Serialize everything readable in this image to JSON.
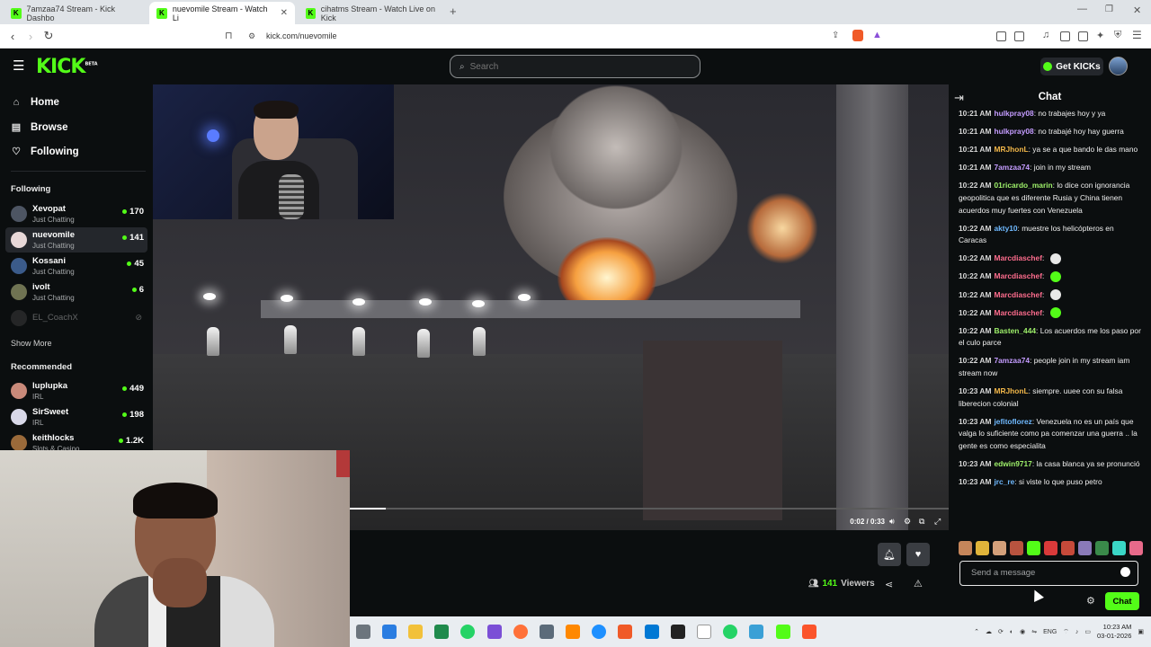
{
  "browser": {
    "tabs": [
      {
        "label": "7amzaa74 Stream - Kick Dashbo",
        "active": false
      },
      {
        "label": "nuevomile Stream - Watch Li",
        "active": true
      },
      {
        "label": "cihatms Stream - Watch Live on Kick",
        "active": false
      }
    ],
    "url": "kick.com/nuevomile"
  },
  "header": {
    "logo": "KICK",
    "logo_tag": "BETA",
    "search_placeholder": "Search",
    "get_kicks_label": "Get KICKs"
  },
  "sidebar": {
    "nav": [
      {
        "label": "Home",
        "icon": "home-icon"
      },
      {
        "label": "Browse",
        "icon": "browse-icon"
      },
      {
        "label": "Following",
        "icon": "heart-icon"
      }
    ],
    "following_title": "Following",
    "following": [
      {
        "name": "Xevopat",
        "category": "Just Chatting",
        "viewers": "170"
      },
      {
        "name": "nuevomile",
        "category": "Just Chatting",
        "viewers": "141"
      },
      {
        "name": "Kossani",
        "category": "Just Chatting",
        "viewers": "45"
      },
      {
        "name": "ivolt",
        "category": "Just Chatting",
        "viewers": "6"
      },
      {
        "name": "EL_CoachX",
        "category": "",
        "viewers": ""
      }
    ],
    "show_more": "Show More",
    "recommended_title": "Recommended",
    "recommended": [
      {
        "name": "luplupka",
        "category": "IRL",
        "viewers": "449"
      },
      {
        "name": "SirSweet",
        "category": "IRL",
        "viewers": "198"
      },
      {
        "name": "keithlocks",
        "category": "Slots & Casino",
        "viewers": "1.2K"
      }
    ]
  },
  "player": {
    "time": "0:02 / 0:33",
    "progress": 0.06
  },
  "stream_info": {
    "viewers_count": "141",
    "viewers_label": "Viewers"
  },
  "chat": {
    "title": "Chat",
    "messages": [
      {
        "time": "10:21 AM",
        "user": "hulkpray08",
        "color": "#c49cff",
        "text": "no trabajes hoy y ya"
      },
      {
        "time": "10:21 AM",
        "user": "hulkpray08",
        "color": "#c49cff",
        "text": "no trabajé hoy hay guerra"
      },
      {
        "time": "10:21 AM",
        "user": "MRJhonL",
        "color": "#f2b749",
        "text": "ya se a que bando le das mano"
      },
      {
        "time": "10:21 AM",
        "user": "7amzaa74",
        "color": "#c49cff",
        "text": "join in my stream"
      },
      {
        "time": "10:22 AM",
        "user": "01ricardo_marin",
        "color": "#9ef06a",
        "text": "lo dice con ignorancia geopolitica que es diferente Rusia y China tienen acuerdos muy fuertes con Venezuela"
      },
      {
        "time": "10:22 AM",
        "user": "akty10",
        "color": "#6fb9ff",
        "text": "muestre los helicópteros en Caracas"
      },
      {
        "time": "10:22 AM",
        "user": "Marcdiaschef",
        "color": "#ff6d8e",
        "text": "",
        "emote": "#e8e8e8"
      },
      {
        "time": "10:22 AM",
        "user": "Marcdiaschef",
        "color": "#ff6d8e",
        "text": "",
        "emote": "#53fc18"
      },
      {
        "time": "10:22 AM",
        "user": "Marcdiaschef",
        "color": "#ff6d8e",
        "text": "",
        "emote": "#e8e8e8"
      },
      {
        "time": "10:22 AM",
        "user": "Marcdiaschef",
        "color": "#ff6d8e",
        "text": "",
        "emote": "#53fc18"
      },
      {
        "time": "10:22 AM",
        "user": "Basten_444",
        "color": "#9ef06a",
        "text": "Los acuerdos me los paso por el culo parce"
      },
      {
        "time": "10:22 AM",
        "user": "7amzaa74",
        "color": "#c49cff",
        "text": "people join in my stream iam stream now"
      },
      {
        "time": "10:23 AM",
        "user": "MRJhonL",
        "color": "#f2b749",
        "text": "siempre. uuee con su falsa liberecion colonial"
      },
      {
        "time": "10:23 AM",
        "user": "jefitoflorez",
        "color": "#6fb9ff",
        "text": "Venezuela no es un país que valga lo suficiente como pa comenzar una guerra .. la gente es como especialita"
      },
      {
        "time": "10:23 AM",
        "user": "edwin9717",
        "color": "#9ef06a",
        "text": "la casa blanca ya se pronunció"
      },
      {
        "time": "10:23 AM",
        "user": "jrc_re",
        "color": "#6fb9ff",
        "text": "si viste lo que puso petro"
      }
    ],
    "input_placeholder": "Send a message",
    "send_label": "Chat"
  },
  "taskbar": {
    "lang": "ENG",
    "time": "10:23 AM",
    "date": "03-01-2026"
  }
}
